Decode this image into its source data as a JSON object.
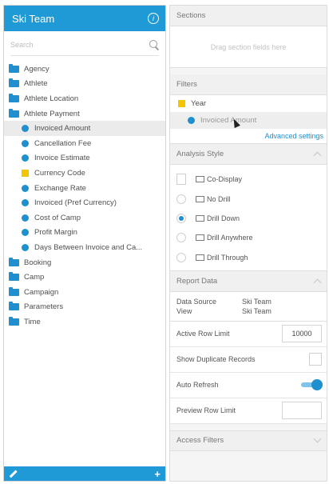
{
  "left_panel": {
    "title": "Ski Team",
    "search_placeholder": "Search",
    "tree": [
      {
        "type": "folder",
        "label": "Agency"
      },
      {
        "type": "folder",
        "label": "Athlete"
      },
      {
        "type": "folder",
        "label": "Athlete Location"
      },
      {
        "type": "folder",
        "label": "Athlete Payment"
      },
      {
        "type": "measure",
        "label": "Invoiced Amount",
        "selected": true
      },
      {
        "type": "measure",
        "label": "Cancellation Fee"
      },
      {
        "type": "measure",
        "label": "Invoice Estimate"
      },
      {
        "type": "dimension",
        "label": "Currency Code"
      },
      {
        "type": "measure",
        "label": "Exchange Rate"
      },
      {
        "type": "measure",
        "label": "Invoiced (Pref Currency)"
      },
      {
        "type": "measure",
        "label": "Cost of Camp"
      },
      {
        "type": "measure",
        "label": "Profit Margin"
      },
      {
        "type": "measure",
        "label": "Days Between Invoice and Ca..."
      },
      {
        "type": "folder",
        "label": "Booking"
      },
      {
        "type": "folder",
        "label": "Camp"
      },
      {
        "type": "folder",
        "label": "Campaign"
      },
      {
        "type": "folder",
        "label": "Parameters"
      },
      {
        "type": "folder",
        "label": "Time"
      }
    ]
  },
  "sections": {
    "title": "Sections",
    "placeholder": "Drag section fields here"
  },
  "filters": {
    "title": "Filters",
    "items": [
      "Year",
      "Invoiced Amount"
    ],
    "advanced_link": "Advanced settings"
  },
  "analysis_style": {
    "title": "Analysis Style",
    "options": [
      {
        "label": "Co-Display",
        "control": "checkbox",
        "checked": false
      },
      {
        "label": "No Drill",
        "control": "radio",
        "checked": false
      },
      {
        "label": "Drill Down",
        "control": "radio",
        "checked": true
      },
      {
        "label": "Drill Anywhere",
        "control": "radio",
        "checked": false
      },
      {
        "label": "Drill Through",
        "control": "radio",
        "checked": false
      }
    ]
  },
  "report_data": {
    "title": "Report Data",
    "data_source_label": "Data Source",
    "data_source_value": "Ski Team",
    "view_label": "View",
    "view_value": "Ski Team",
    "active_row_limit_label": "Active Row Limit",
    "active_row_limit_value": "10000",
    "show_duplicates_label": "Show Duplicate Records",
    "auto_refresh_label": "Auto Refresh",
    "auto_refresh_on": true,
    "preview_row_limit_label": "Preview Row Limit",
    "preview_row_limit_value": ""
  },
  "access_filters": {
    "title": "Access Filters"
  },
  "colors": {
    "accent": "#1f9ad6",
    "measure": "#1f8fd0",
    "dimension": "#f2c500"
  }
}
